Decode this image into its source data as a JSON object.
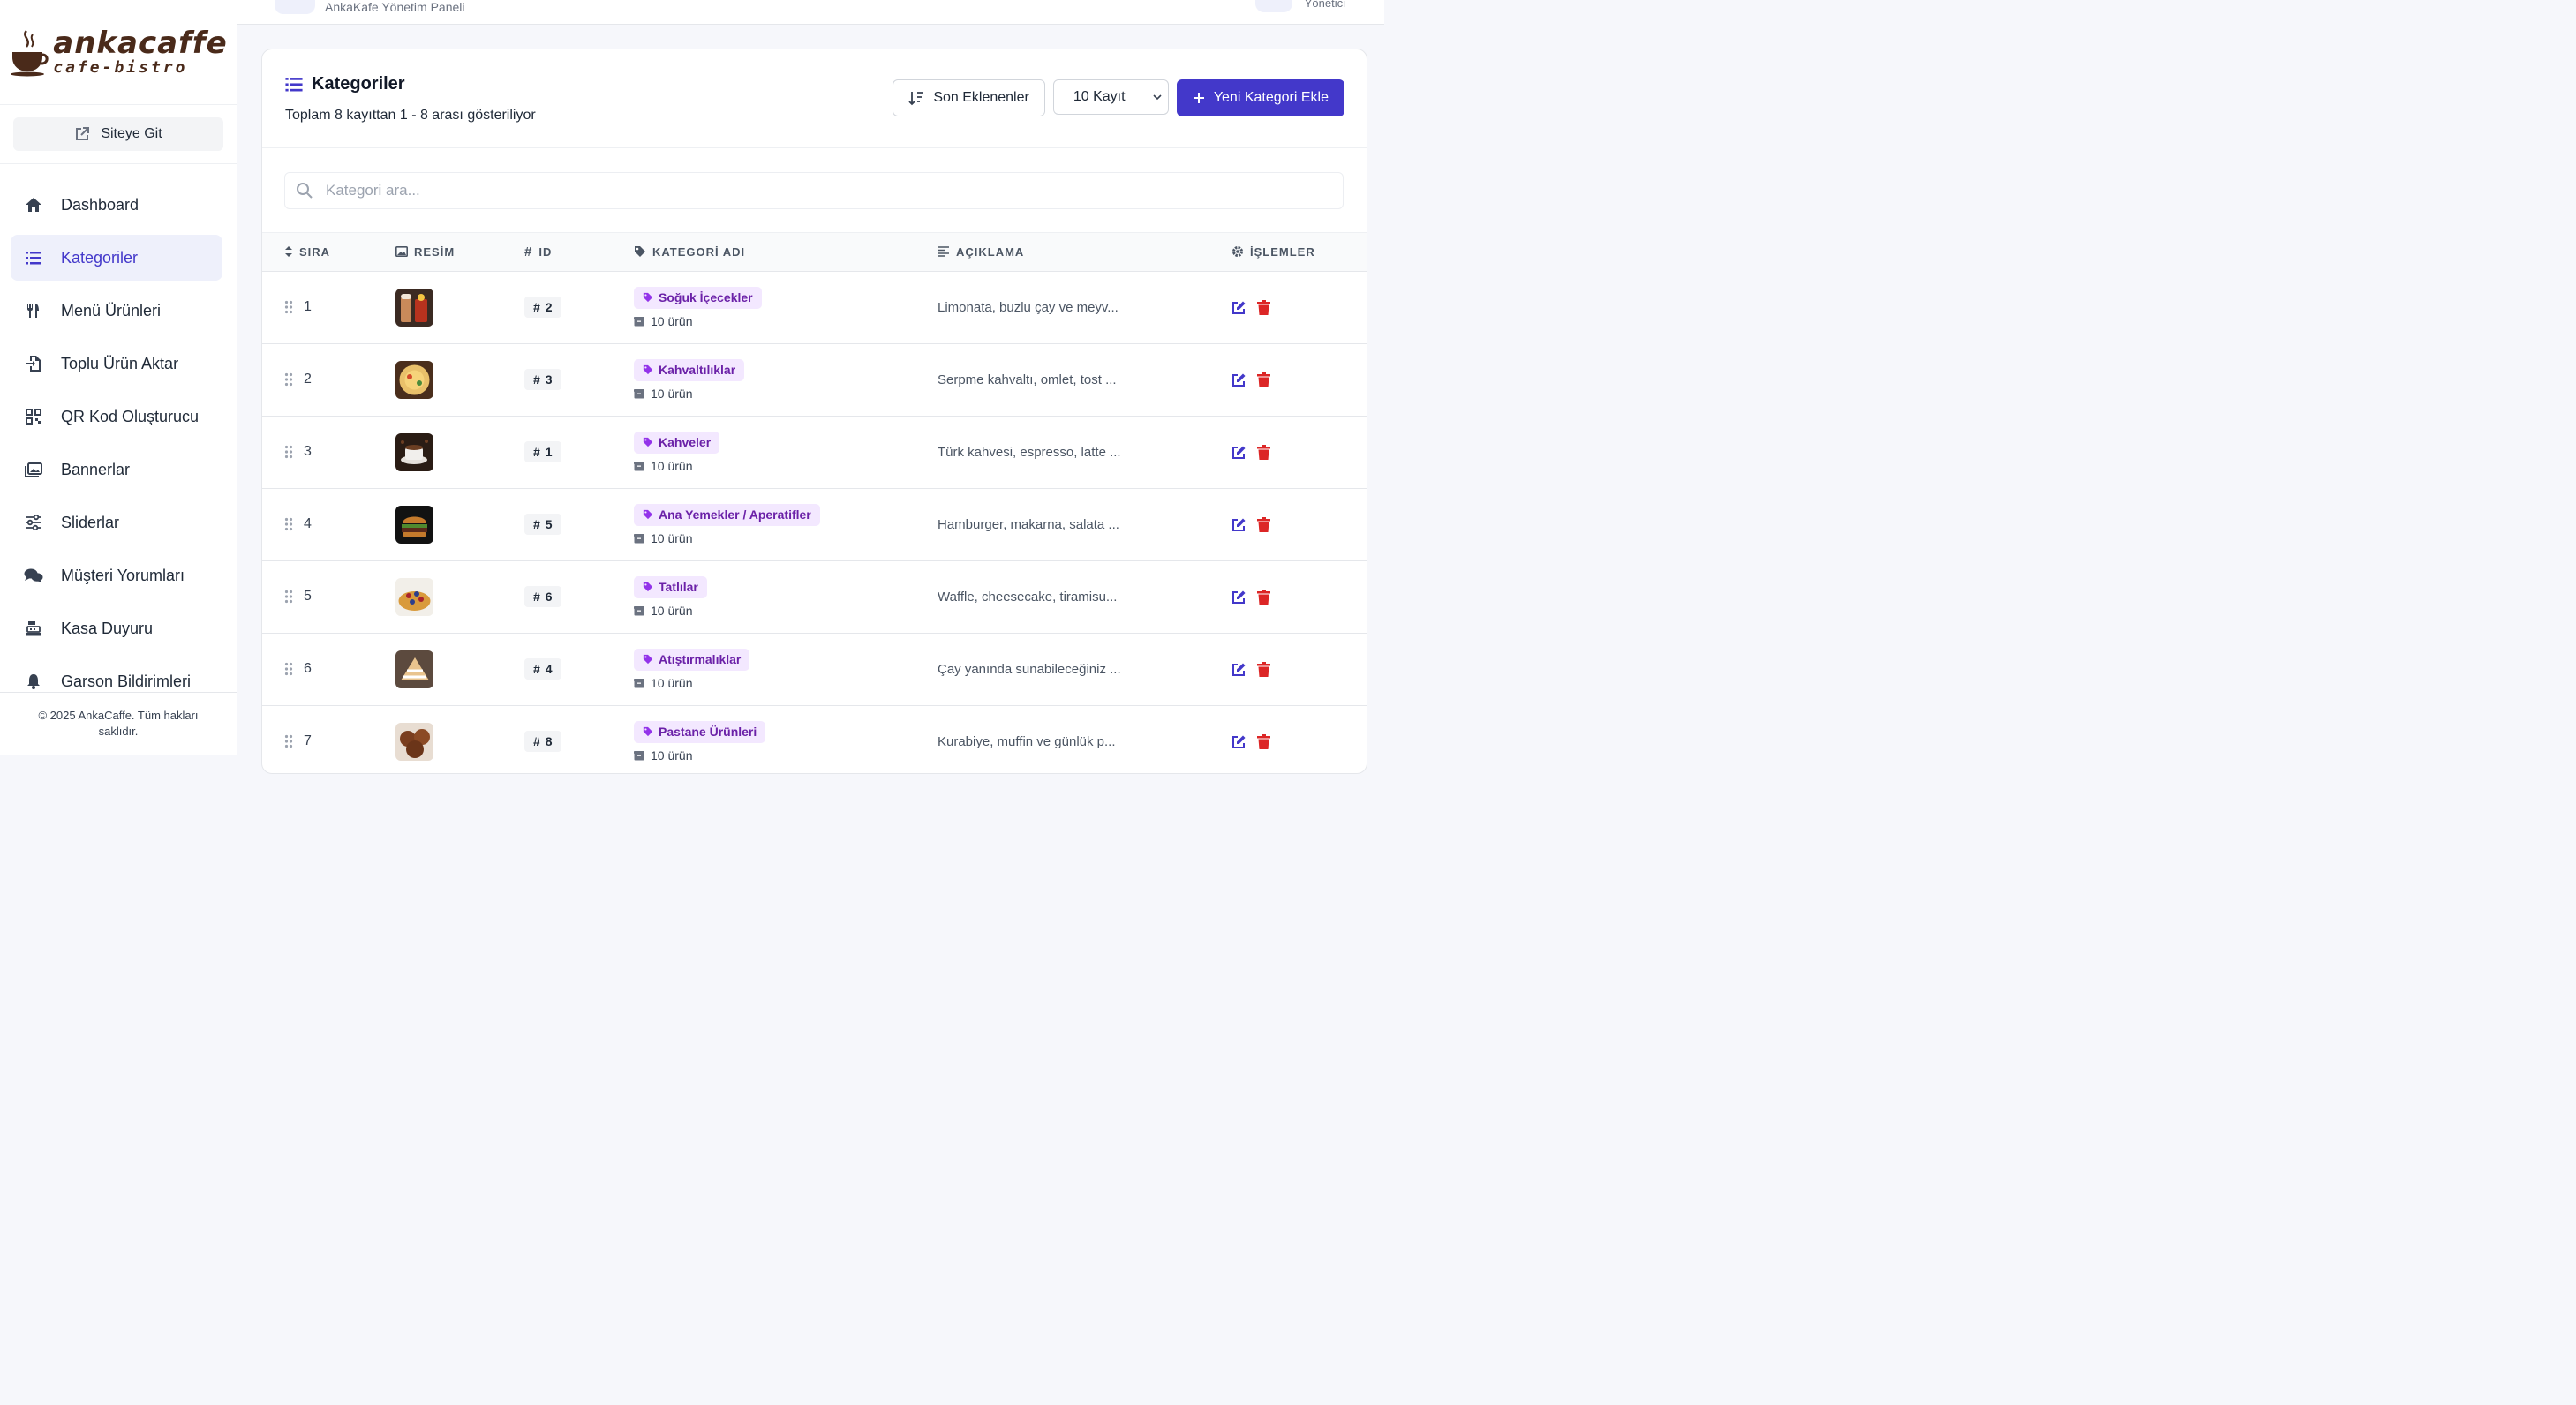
{
  "brand": {
    "name": "ankacaffe",
    "tagline": "cafe-bistro"
  },
  "sidebar": {
    "site_button": "Siteye Git",
    "items": [
      {
        "label": "Dashboard",
        "icon": "home-icon",
        "active": false
      },
      {
        "label": "Kategoriler",
        "icon": "list-icon",
        "active": true
      },
      {
        "label": "Menü Ürünleri",
        "icon": "utensils-icon",
        "active": false
      },
      {
        "label": "Toplu Ürün Aktar",
        "icon": "file-import-icon",
        "active": false
      },
      {
        "label": "QR Kod Oluşturucu",
        "icon": "qrcode-icon",
        "active": false
      },
      {
        "label": "Bannerlar",
        "icon": "images-icon",
        "active": false
      },
      {
        "label": "Sliderlar",
        "icon": "sliders-icon",
        "active": false
      },
      {
        "label": "Müşteri Yorumları",
        "icon": "comments-icon",
        "active": false
      },
      {
        "label": "Kasa Duyuru",
        "icon": "cash-register-icon",
        "active": false
      },
      {
        "label": "Garson Bildirimleri",
        "icon": "bell-icon",
        "active": false
      }
    ],
    "footer": "© 2025 AnkaCaffe. Tüm hakları saklıdır."
  },
  "topbar": {
    "panel_name": "AnkaKafe Yönetim Paneli",
    "role": "Yönetici"
  },
  "page": {
    "title": "Kategoriler",
    "summary": "Toplam 8 kayıttan 1 - 8 arası gösteriliyor",
    "sort_button": "Son Eklenenler",
    "page_size": "10 Kayıt",
    "add_button": "Yeni Kategori Ekle",
    "search_placeholder": "Kategori ara..."
  },
  "table": {
    "headers": {
      "sira": "SIRA",
      "resim": "RESİM",
      "id": "ID",
      "name": "KATEGORİ ADI",
      "desc": "AÇIKLAMA",
      "ops": "İŞLEMLER"
    },
    "rows": [
      {
        "sira": "1",
        "id": "2",
        "name": "Soğuk İçecekler",
        "count": "10 ürün",
        "desc": "Limonata, buzlu çay ve meyv...",
        "thumb": "drinks"
      },
      {
        "sira": "2",
        "id": "3",
        "name": "Kahvaltılıklar",
        "count": "10 ürün",
        "desc": "Serpme kahvaltı, omlet, tost ...",
        "thumb": "breakfast"
      },
      {
        "sira": "3",
        "id": "1",
        "name": "Kahveler",
        "count": "10 ürün",
        "desc": "Türk kahvesi, espresso, latte ...",
        "thumb": "coffee"
      },
      {
        "sira": "4",
        "id": "5",
        "name": "Ana Yemekler / Aperatifler",
        "count": "10 ürün",
        "desc": "Hamburger, makarna, salata ...",
        "thumb": "burger"
      },
      {
        "sira": "5",
        "id": "6",
        "name": "Tatlılar",
        "count": "10 ürün",
        "desc": "Waffle, cheesecake, tiramisu...",
        "thumb": "waffle"
      },
      {
        "sira": "6",
        "id": "4",
        "name": "Atıştırmalıklar",
        "count": "10 ürün",
        "desc": "Çay yanında sunabileceğiniz ...",
        "thumb": "cake"
      },
      {
        "sira": "7",
        "id": "8",
        "name": "Pastane Ürünleri",
        "count": "10 ürün",
        "desc": "Kurabiye, muffin ve günlük p...",
        "thumb": "muffin"
      }
    ]
  },
  "colors": {
    "accent": "#4338ca",
    "badge_bg": "#f3e8ff",
    "badge_text": "#6b21a8",
    "delete": "#dc2626"
  }
}
